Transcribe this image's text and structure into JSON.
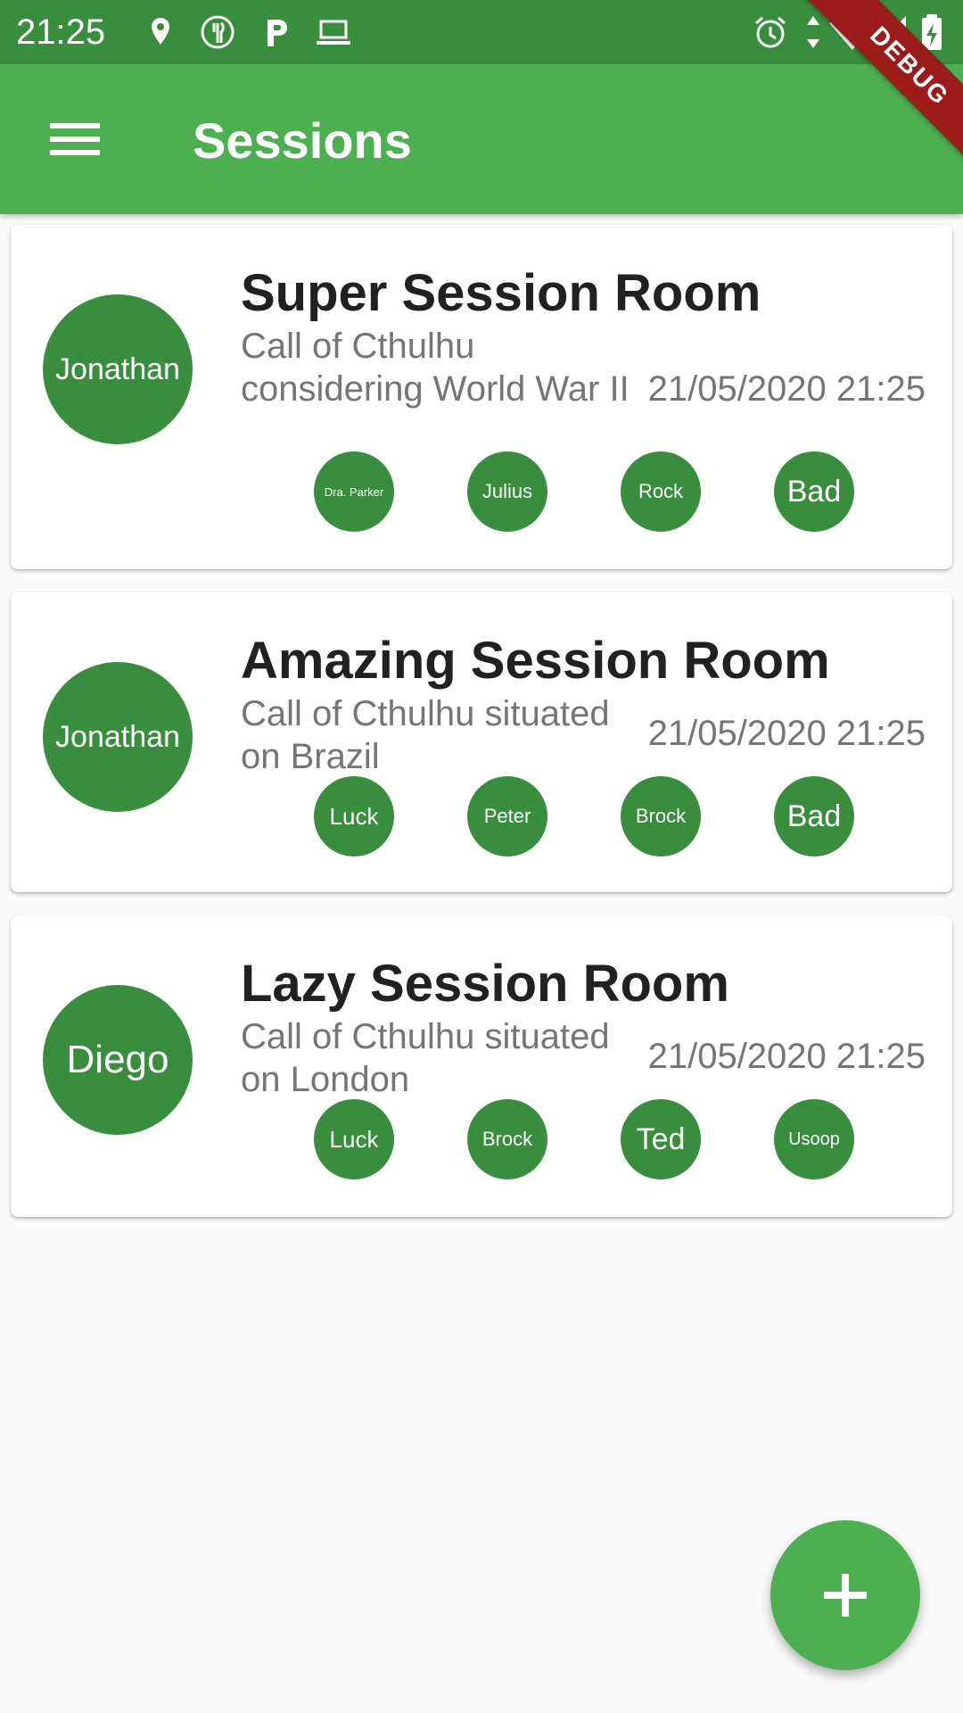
{
  "status_bar": {
    "time": "21:25",
    "left_icons": [
      "location-pin-icon",
      "restaurant-icon",
      "parking-icon",
      "laptop-icon"
    ],
    "right_icons": [
      "alarm-icon",
      "data-transfer-icon",
      "wifi-icon",
      "cell-signal-icon",
      "battery-charging-icon"
    ]
  },
  "app_bar": {
    "title": "Sessions",
    "menu_icon": "menu-icon"
  },
  "debug_banner": "DEBUG",
  "sessions": [
    {
      "master": "Jonathan",
      "title": "Super Session Room",
      "description": "Call of Cthulhu considering World War II",
      "date": "21/05/2020 21:25",
      "players": [
        "Dra. Parker",
        "Julius",
        "Rock",
        "Bad"
      ]
    },
    {
      "master": "Jonathan",
      "title": "Amazing Session Room",
      "description": "Call of Cthulhu situated on Brazil",
      "date": "21/05/2020 21:25",
      "players": [
        "Luck",
        "Peter",
        "Brock",
        "Bad"
      ]
    },
    {
      "master": "Diego",
      "title": "Lazy Session Room",
      "description": "Call of Cthulhu situated on London",
      "date": "21/05/2020 21:25",
      "players": [
        "Luck",
        "Brock",
        "Ted",
        "Usoop"
      ]
    }
  ],
  "fab_icon": "add-icon",
  "colors": {
    "primary": "#4caf50",
    "primary_dark": "#388e3c",
    "debug": "#9c1b1b",
    "background": "#fafafa"
  }
}
